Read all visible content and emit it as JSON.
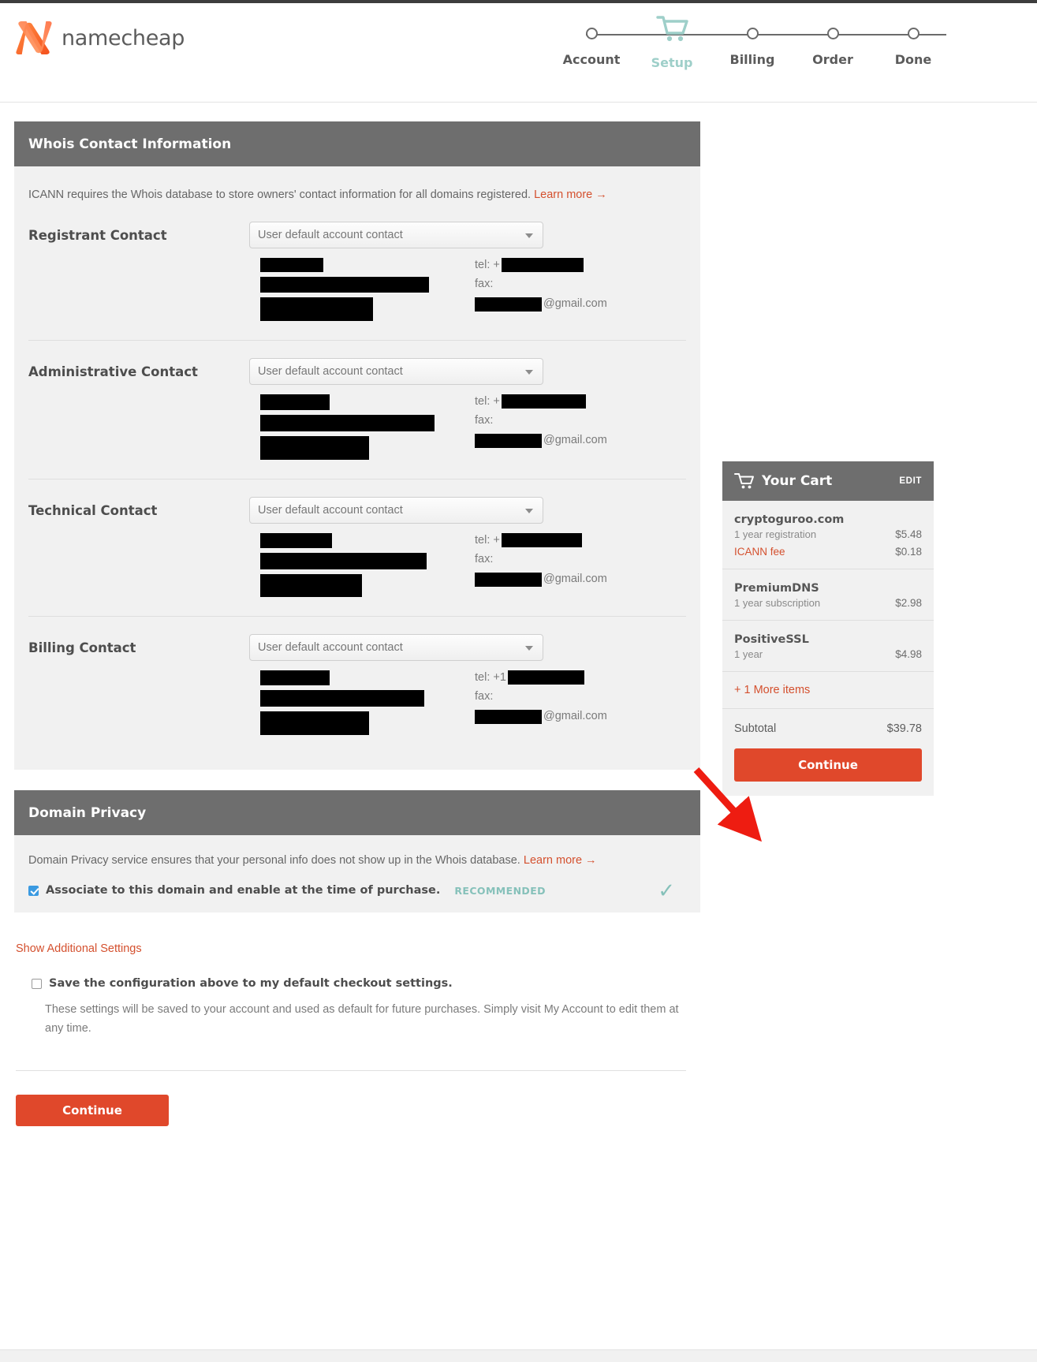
{
  "brand": {
    "name": "namecheap"
  },
  "stepper": {
    "steps": [
      {
        "label": "Account",
        "active": false
      },
      {
        "label": "Setup",
        "active": true
      },
      {
        "label": "Billing",
        "active": false
      },
      {
        "label": "Order",
        "active": false
      },
      {
        "label": "Done",
        "active": false
      }
    ]
  },
  "whois": {
    "title": "Whois Contact Information",
    "intro": "ICANN requires the Whois database to store owners' contact information for all domains registered.",
    "learn_more": "Learn more →",
    "contacts": [
      {
        "label": "Registrant Contact",
        "select_value": "User default account contact",
        "tel_label": "tel: +",
        "fax_label": "fax:",
        "email_suffix": "@gmail.com",
        "redacted": true
      },
      {
        "label": "Administrative Contact",
        "select_value": "User default account contact",
        "tel_label": "tel: +",
        "fax_label": "fax:",
        "email_suffix": "@gmail.com",
        "redacted": true
      },
      {
        "label": "Technical Contact",
        "select_value": "User default account contact",
        "tel_label": "tel: +",
        "fax_label": "fax:",
        "email_suffix": "@gmail.com",
        "redacted": true
      },
      {
        "label": "Billing Contact",
        "select_value": "User default account contact",
        "tel_label": "tel: +1",
        "fax_label": "fax:",
        "email_suffix": "@gmail.com",
        "redacted": true
      }
    ]
  },
  "privacy": {
    "title": "Domain Privacy",
    "text": "Domain Privacy service ensures that your personal info does not show up in the Whois database.",
    "learn_more": "Learn more →",
    "checkbox_label": "Associate to this domain and enable at the time of purchase.",
    "checkbox_checked": true,
    "badge": "RECOMMENDED",
    "check_glyph": "✓"
  },
  "additional": {
    "show_settings_link": "Show Additional Settings",
    "save_label": "Save the configuration above to my default checkout settings.",
    "save_checked": false,
    "save_note": "These settings will be saved to your account and used as default for future purchases. Simply visit My Account to edit them at any time.",
    "continue_label": "Continue"
  },
  "cart": {
    "title": "Your Cart",
    "edit_label": "EDIT",
    "items": [
      {
        "name": "cryptoguroo.com",
        "sub": "1 year registration",
        "price": "$5.48",
        "fee_label": "ICANN fee",
        "fee_price": "$0.18"
      },
      {
        "name": "PremiumDNS",
        "sub": "1 year subscription",
        "price": "$2.98",
        "fee_label": "",
        "fee_price": ""
      },
      {
        "name": "PositiveSSL",
        "sub": "1 year",
        "price": "$4.98",
        "fee_label": "",
        "fee_price": ""
      }
    ],
    "more_items": "+ 1 More items",
    "subtotal_label": "Subtotal",
    "subtotal_value": "$39.78",
    "continue_label": "Continue"
  },
  "colors": {
    "accent_red": "#e0482b",
    "teal": "#9ecfc9",
    "header_gray": "#6e6e6e",
    "annotation_red": "#ee1c11"
  }
}
